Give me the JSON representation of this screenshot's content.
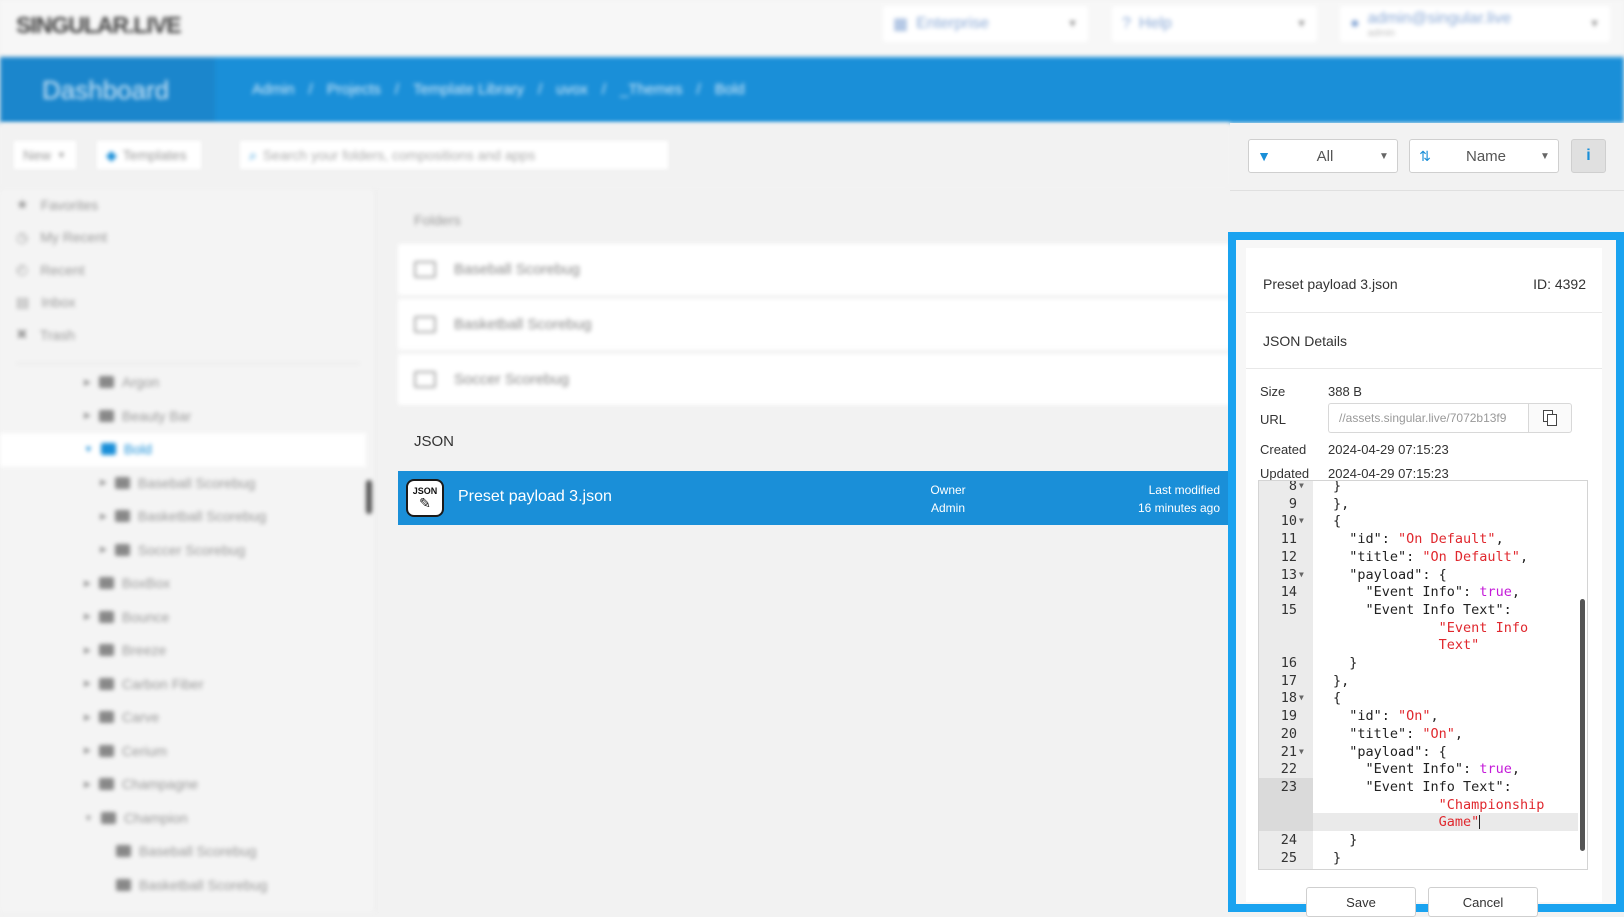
{
  "topbar": {
    "logo": "SINGULAR.LIVE",
    "org": "Enterprise",
    "help": "Help",
    "user": "admin@singular.live",
    "user_sub": "admin"
  },
  "header": {
    "dashboard": "Dashboard",
    "breadcrumbs": [
      "Admin",
      "/",
      "Projects",
      "/",
      "Template Library",
      "/",
      "uvox",
      "/",
      "_Themes",
      "/",
      "Bold"
    ]
  },
  "toolbar": {
    "new_label": "New",
    "templates_label": "Templates",
    "search_placeholder": "Search your folders, compositions and apps"
  },
  "sidebar": {
    "items": [
      "Favorites",
      "My Recent",
      "Recent",
      "Inbox",
      "Trash"
    ],
    "tree": [
      "Argon",
      "Beauty Bar",
      "Bold",
      "Baseball Scorebug",
      "Basketball Scorebug",
      "Soccer Scorebug",
      "BoxBox",
      "Bounce",
      "Breeze",
      "Carbon Fiber",
      "Carve",
      "Cerium",
      "Champagne",
      "Champion",
      "Baseball Scorebug",
      "Basketball Scorebug"
    ]
  },
  "main": {
    "folders_label": "Folders",
    "folders": [
      "Baseball Scorebug",
      "Basketball Scorebug",
      "Soccer Scorebug"
    ],
    "json_label": "JSON",
    "json_item": {
      "icon_text": "JSON",
      "name": "Preset payload 3.json",
      "owner_label": "Owner",
      "owner": "Admin",
      "modified_label": "Last modified",
      "modified": "16 minutes ago"
    }
  },
  "filters": {
    "filter_value": "All",
    "sort_value": "Name",
    "info_label": "i"
  },
  "details": {
    "title": "Preset payload 3.json",
    "id": "ID: 4392",
    "section": "JSON Details",
    "size_label": "Size",
    "size": "388 B",
    "url_label": "URL",
    "url": "//assets.singular.live/7072b13f9",
    "created_label": "Created",
    "created": "2024-04-29 07:15:23",
    "updated_label": "Updated",
    "updated": "2024-04-29 07:15:23",
    "save_label": "Save",
    "cancel_label": "Cancel"
  },
  "editor": {
    "lines": [
      {
        "n": "8",
        "fold": true,
        "segs": [
          {
            "t": "}"
          }
        ]
      },
      {
        "n": "9",
        "segs": [
          {
            "t": "},"
          }
        ]
      },
      {
        "n": "10",
        "fold": true,
        "segs": [
          {
            "t": "{"
          }
        ]
      },
      {
        "n": "11",
        "segs": [
          {
            "t": "  \"id\": "
          },
          {
            "t": "\"On Default\"",
            "c": "str"
          },
          {
            "t": ","
          }
        ]
      },
      {
        "n": "12",
        "segs": [
          {
            "t": "  \"title\": "
          },
          {
            "t": "\"On Default\"",
            "c": "str"
          },
          {
            "t": ","
          }
        ]
      },
      {
        "n": "13",
        "fold": true,
        "segs": [
          {
            "t": "  \"payload\": {"
          }
        ]
      },
      {
        "n": "14",
        "segs": [
          {
            "t": "    \"Event Info\": "
          },
          {
            "t": "true",
            "c": "bool"
          },
          {
            "t": ","
          }
        ]
      },
      {
        "n": "15",
        "segs": [
          {
            "t": "    \"Event Info Text\":"
          }
        ]
      },
      {
        "n": "",
        "segs": [
          {
            "t": "             "
          },
          {
            "t": "\"Event Info",
            "c": "str"
          }
        ]
      },
      {
        "n": "",
        "segs": [
          {
            "t": "             "
          },
          {
            "t": "Text\"",
            "c": "str"
          }
        ]
      },
      {
        "n": "16",
        "segs": [
          {
            "t": "  }"
          }
        ]
      },
      {
        "n": "17",
        "segs": [
          {
            "t": "},"
          }
        ]
      },
      {
        "n": "18",
        "fold": true,
        "segs": [
          {
            "t": "{"
          }
        ]
      },
      {
        "n": "19",
        "segs": [
          {
            "t": "  \"id\": "
          },
          {
            "t": "\"On\"",
            "c": "str"
          },
          {
            "t": ","
          }
        ]
      },
      {
        "n": "20",
        "segs": [
          {
            "t": "  \"title\": "
          },
          {
            "t": "\"On\"",
            "c": "str"
          },
          {
            "t": ","
          }
        ]
      },
      {
        "n": "21",
        "fold": true,
        "segs": [
          {
            "t": "  \"payload\": {"
          }
        ]
      },
      {
        "n": "22",
        "segs": [
          {
            "t": "    \"Event Info\": "
          },
          {
            "t": "true",
            "c": "bool"
          },
          {
            "t": ","
          }
        ]
      },
      {
        "n": "23",
        "active": true,
        "segs": [
          {
            "t": "    \"Event Info Text\":"
          }
        ]
      },
      {
        "n": "",
        "active": true,
        "segs": [
          {
            "t": "             "
          },
          {
            "t": "\"Championship",
            "c": "str"
          }
        ]
      },
      {
        "n": "",
        "active": true,
        "cursor": true,
        "segs": [
          {
            "t": "             "
          },
          {
            "t": "Game\"",
            "c": "str"
          }
        ]
      },
      {
        "n": "24",
        "segs": [
          {
            "t": "  }"
          }
        ]
      },
      {
        "n": "25",
        "segs": [
          {
            "t": "}"
          }
        ]
      }
    ]
  }
}
